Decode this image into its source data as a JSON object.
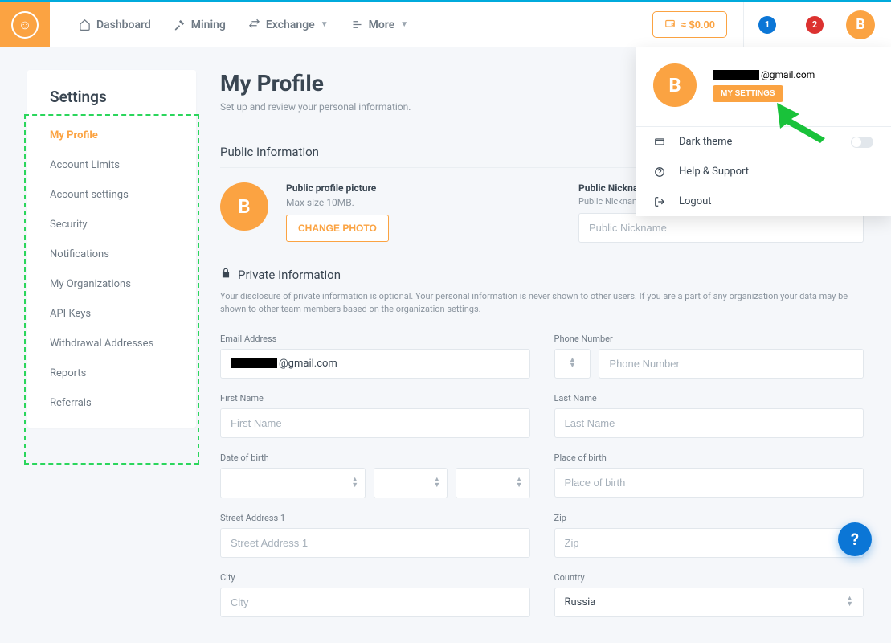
{
  "header": {
    "nav": {
      "dashboard": "Dashboard",
      "mining": "Mining",
      "exchange": "Exchange",
      "more": "More"
    },
    "wallet_amount": "≈ $0.00",
    "badge_blue": "1",
    "badge_red": "2",
    "avatar_letter": "B"
  },
  "sidebar": {
    "title": "Settings",
    "items": {
      "0": {
        "label": "My Profile"
      },
      "1": {
        "label": "Account Limits"
      },
      "2": {
        "label": "Account settings"
      },
      "3": {
        "label": "Security"
      },
      "4": {
        "label": "Notifications"
      },
      "5": {
        "label": "My Organizations"
      },
      "6": {
        "label": "API Keys"
      },
      "7": {
        "label": "Withdrawal Addresses"
      },
      "8": {
        "label": "Reports"
      },
      "9": {
        "label": "Referrals"
      }
    }
  },
  "page": {
    "title": "My Profile",
    "subtitle": "Set up and review your personal information."
  },
  "public_section": {
    "heading": "Public Information",
    "pp_title": "Public profile picture",
    "pp_hint": "Max size 10MB.",
    "pp_avatar_letter": "B",
    "change_photo": "CHANGE PHOTO",
    "nickname_label": "Public Nickname",
    "nickname_sub": "Public Nickname",
    "nickname_placeholder": "Public Nickname"
  },
  "private_section": {
    "heading": "Private Information",
    "desc": "Your disclosure of private information is optional. Your personal information is never shown to other users. If you are a part of any organization your data may be shown to other team members based on the organization settings."
  },
  "form": {
    "email_label": "Email Address",
    "email_suffix": "@gmail.com",
    "phone_label": "Phone Number",
    "phone_placeholder": "Phone Number",
    "first_name_label": "First Name",
    "first_name_placeholder": "First Name",
    "last_name_label": "Last Name",
    "last_name_placeholder": "Last Name",
    "dob_label": "Date of birth",
    "pob_label": "Place of birth",
    "pob_placeholder": "Place of birth",
    "street_label": "Street Address 1",
    "street_placeholder": "Street Address 1",
    "zip_label": "Zip",
    "zip_placeholder": "Zip",
    "city_label": "City",
    "city_placeholder": "City",
    "country_label": "Country",
    "country_value": "Russia"
  },
  "dropdown": {
    "avatar_letter": "B",
    "email_suffix": "@gmail.com",
    "settings_btn": "MY SETTINGS",
    "dark_theme": "Dark theme",
    "help": "Help & Support",
    "logout": "Logout"
  }
}
